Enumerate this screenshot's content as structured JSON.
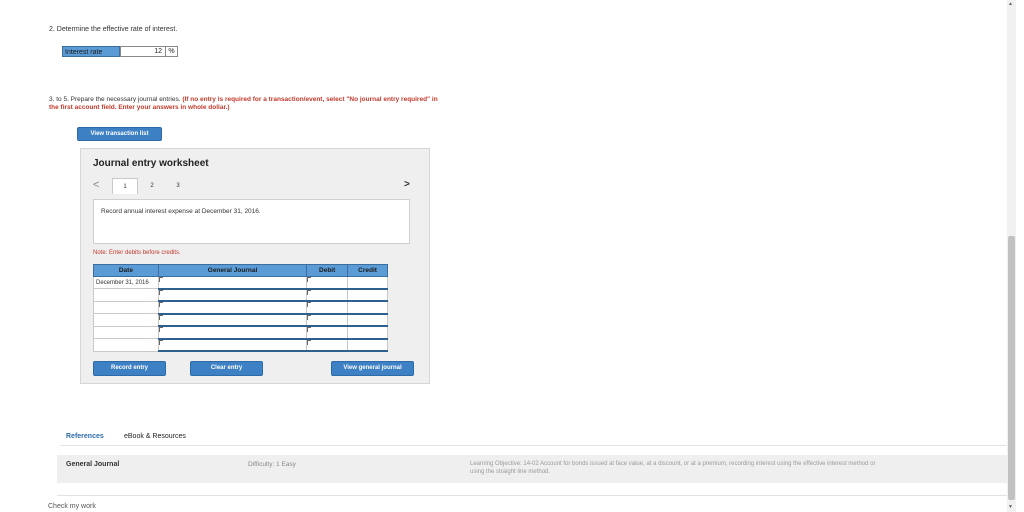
{
  "question2": {
    "text": "2. Determine the effective rate of interest."
  },
  "interest_rate": {
    "label": "Interest rate",
    "value": "12",
    "unit": "%"
  },
  "question35": {
    "prefix": "3. to 5. Prepare the necessary journal entries. ",
    "instruction": "(If no entry is required for a transaction/event, select \"No journal entry required\" in the first account field. Enter your answers in whole dollar.)"
  },
  "buttons": {
    "view_transaction": "View transaction list",
    "record_entry": "Record entry",
    "clear_entry": "Clear entry",
    "view_general_journal": "View general journal"
  },
  "worksheet": {
    "title": "Journal entry worksheet",
    "tabs": [
      "1",
      "2",
      "3"
    ],
    "active_tab": 0,
    "nav_prev": "<",
    "nav_next": ">",
    "description": "Record annual interest expense at December 31, 2016.",
    "note": "Note: Enter debits before credits."
  },
  "journal_table": {
    "headers": [
      "Date",
      "General Journal",
      "Debit",
      "Credit"
    ],
    "rows": [
      {
        "date": "December 31, 2016",
        "account": "",
        "debit": "",
        "credit": ""
      },
      {
        "date": "",
        "account": "",
        "debit": "",
        "credit": ""
      },
      {
        "date": "",
        "account": "",
        "debit": "",
        "credit": ""
      },
      {
        "date": "",
        "account": "",
        "debit": "",
        "credit": ""
      },
      {
        "date": "",
        "account": "",
        "debit": "",
        "credit": ""
      },
      {
        "date": "",
        "account": "",
        "debit": "",
        "credit": ""
      }
    ]
  },
  "references": {
    "tabs": [
      "References",
      "eBook & Resources"
    ],
    "item_label": "General Journal",
    "difficulty": "Difficulty: 1 Easy",
    "objective": "Learning Objective: 14-02 Account for bonds issued at face value, at a discount, or at a premium, recording interest using the effective interest method or using the straight line method."
  },
  "footer": {
    "check_my_work": "Check my work"
  },
  "colors": {
    "header_blue": "#5b9bd5",
    "button_blue": "#3d80c4",
    "note_red": "#c0392b"
  }
}
